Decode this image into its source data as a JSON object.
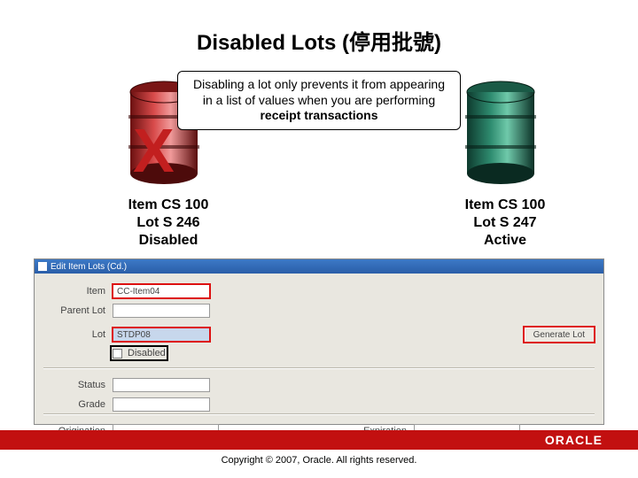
{
  "title": "Disabled Lots (停用批號)",
  "callout": {
    "prefix": "Disabling a lot only prevents it from appearing in a list of values when you are performing ",
    "bold": "receipt transactions"
  },
  "xmark": "X",
  "left_item": {
    "line1": "Item CS 100",
    "line2": "Lot S 246",
    "line3": "Disabled"
  },
  "right_item": {
    "line1": "Item CS 100",
    "line2": "Lot S 247",
    "line3": "Active"
  },
  "form": {
    "window_title": "Edit Item Lots (Cd.)",
    "labels": {
      "item": "Item",
      "parent_lot": "Parent Lot",
      "lot": "Lot",
      "disabled": "Disabled",
      "status": "Status",
      "grade": "Grade",
      "origination": "Origination",
      "expiration": "Expiration"
    },
    "values": {
      "item": "CC-Item04",
      "parent_lot": "",
      "lot": "STDP08",
      "status": "",
      "grade": "",
      "origination": "",
      "expiration": ""
    },
    "buttons": {
      "generate_lot": "Generate Lot"
    }
  },
  "footer": {
    "brand": "ORACLE",
    "copyright": "Copyright © 2007, Oracle. All rights reserved."
  },
  "colors": {
    "accent_red": "#c21010",
    "callout_border": "#000000"
  }
}
